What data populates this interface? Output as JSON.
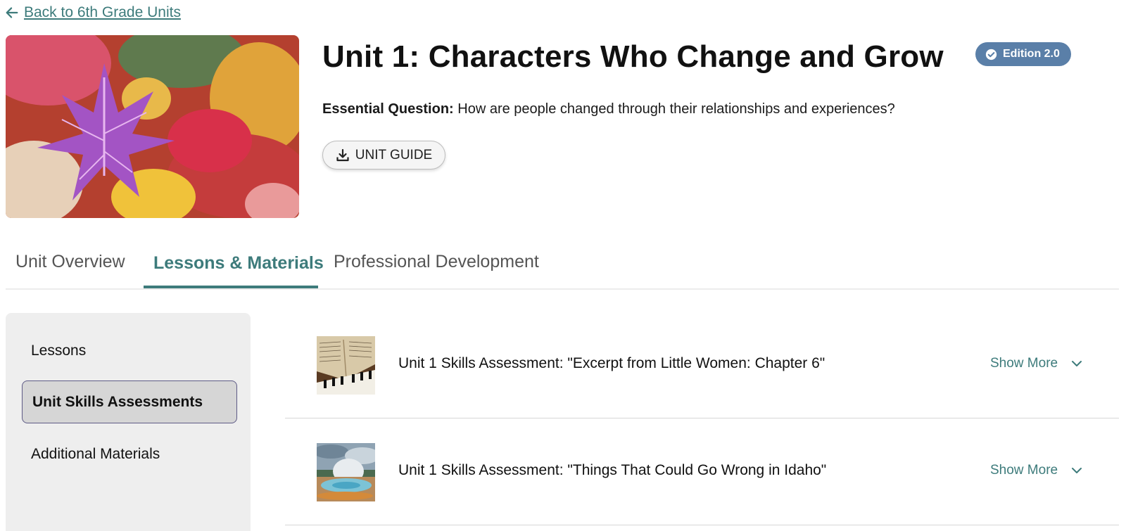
{
  "back_link": {
    "label": "Back to 6th Grade Units"
  },
  "unit": {
    "title": "Unit 1: Characters Who Change and Grow",
    "edition": "Edition 2.0",
    "essential_label": "Essential Question:",
    "essential_question": " How are people changed through their relationships and experiences?",
    "guide_button": "UNIT GUIDE"
  },
  "tabs": [
    {
      "label": "Unit Overview"
    },
    {
      "label": "Lessons & Materials"
    },
    {
      "label": "Professional Development"
    }
  ],
  "sidebar": {
    "items": [
      {
        "label": "Lessons"
      },
      {
        "label": "Unit Skills Assessments"
      },
      {
        "label": "Additional Materials"
      }
    ]
  },
  "assessments": [
    {
      "title": "Unit 1 Skills Assessment: \"Excerpt from Little Women: Chapter 6\"",
      "action": "Show More"
    },
    {
      "title": "Unit 1 Skills Assessment: \"Things That Could Go Wrong in Idaho\"",
      "action": "Show More"
    }
  ],
  "colors": {
    "accent": "#3d7b7b",
    "badge": "#5a7fa8",
    "active_border": "#5d5a85"
  }
}
